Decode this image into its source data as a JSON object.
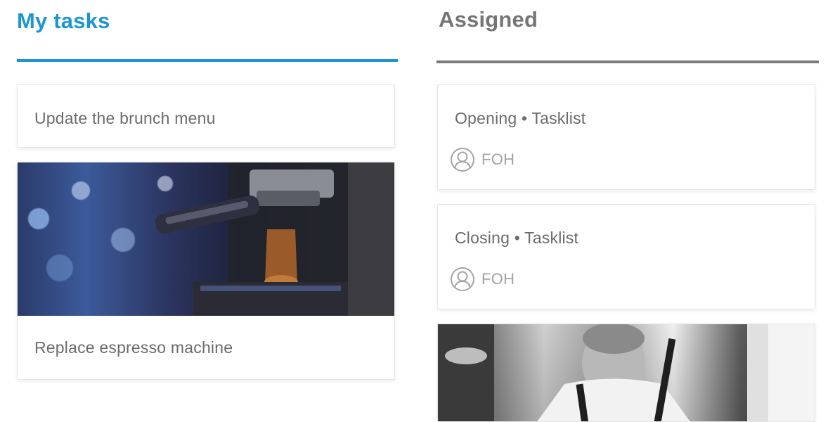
{
  "tabs": {
    "my_tasks": "My tasks",
    "assigned": "Assigned"
  },
  "my_tasks": [
    {
      "title": "Update the brunch menu"
    },
    {
      "title": "Replace espresso machine",
      "image": "espresso-machine-photo"
    }
  ],
  "assigned": [
    {
      "title": "Opening • Tasklist",
      "assignee": "FOH",
      "icon": "user-circle-icon"
    },
    {
      "title": "Closing • Tasklist",
      "assignee": "FOH",
      "icon": "user-circle-icon"
    },
    {
      "image": "chef-photo"
    }
  ],
  "colors": {
    "accent": "#1a96d8",
    "inactive_tab": "#757575",
    "card_text": "#6b6b6b",
    "muted_text": "#a3a3a3"
  }
}
